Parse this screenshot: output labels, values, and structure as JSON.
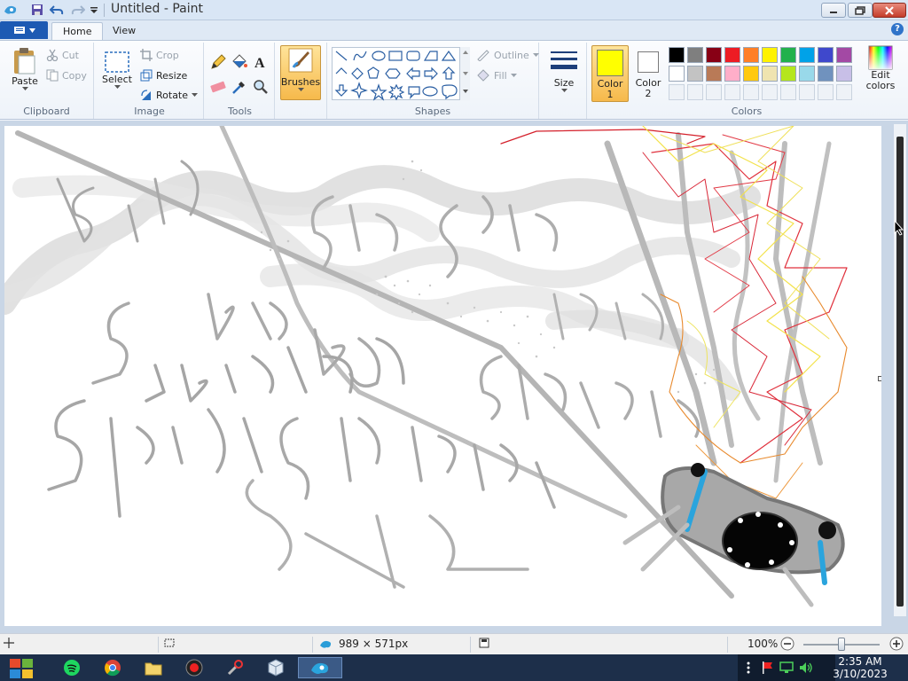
{
  "window": {
    "title": "Untitled - Paint"
  },
  "tabs": [
    {
      "label": "Home"
    },
    {
      "label": "View"
    }
  ],
  "ribbon": {
    "clipboard": {
      "paste": "Paste",
      "cut": "Cut",
      "copy": "Copy",
      "group": "Clipboard"
    },
    "image": {
      "select": "Select",
      "crop": "Crop",
      "resize": "Resize",
      "rotate": "Rotate",
      "group": "Image"
    },
    "tools": {
      "group": "Tools"
    },
    "brushes": {
      "label": "Brushes"
    },
    "shapes": {
      "outline": "Outline",
      "fill": "Fill",
      "group": "Shapes"
    },
    "size": {
      "label": "Size"
    },
    "color1": {
      "label_a": "Color",
      "label_b": "1",
      "value": "#FFFF00"
    },
    "color2": {
      "label_a": "Color",
      "label_b": "2",
      "value": "#FFFFFF"
    },
    "colors": {
      "group": "Colors"
    },
    "edit_colors": {
      "label_a": "Edit",
      "label_b": "colors"
    },
    "palette_row1": [
      "#000000",
      "#7f7f7f",
      "#880015",
      "#ed1c24",
      "#ff7f27",
      "#fff200",
      "#22b14c",
      "#00a2e8",
      "#3f48cc",
      "#a349a4"
    ],
    "palette_row2": [
      "#ffffff",
      "#c3c3c3",
      "#b97a57",
      "#ffaec9",
      "#ffc90e",
      "#efe4b0",
      "#b5e61d",
      "#99d9ea",
      "#7092be",
      "#c8bfe7"
    ]
  },
  "status": {
    "image_size": "989 × 571px",
    "zoom": "100%"
  },
  "taskbar": {
    "time": "2:35 AM",
    "date": "3/10/2023"
  }
}
